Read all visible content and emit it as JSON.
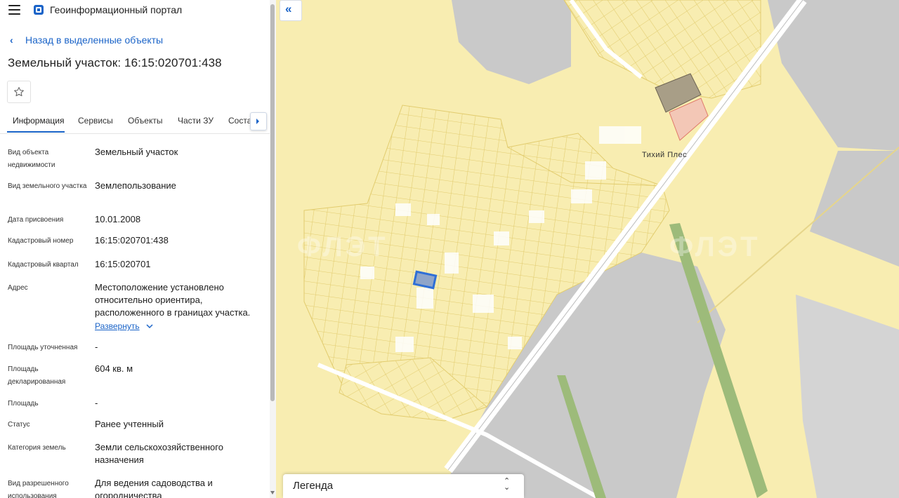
{
  "header": {
    "portal_title": "Геоинформационный портал",
    "menu_icon": "hamburger-icon",
    "logo_icon": "portal-logo-icon"
  },
  "navigation": {
    "back_label": "Назад в выделенные объекты"
  },
  "object": {
    "title": "Земельный участок: 16:15:020701:438",
    "favorite_icon": "star-icon"
  },
  "tabs": [
    {
      "label": "Информация",
      "active": true
    },
    {
      "label": "Сервисы"
    },
    {
      "label": "Объекты"
    },
    {
      "label": "Части ЗУ"
    },
    {
      "label": "Соста"
    }
  ],
  "properties": [
    {
      "label": "Вид объекта недвижимости",
      "value": "Земельный участок"
    },
    {
      "label": "Вид земельного участка",
      "value": "Землепользование"
    },
    {
      "label": "Дата присвоения",
      "value": "10.01.2008"
    },
    {
      "label": "Кадастровый номер",
      "value": "16:15:020701:438"
    },
    {
      "label": "Кадастровый квартал",
      "value": "16:15:020701"
    },
    {
      "label": "Адрес",
      "value": "Местоположение установлено относительно ориентира, расположенного в границах участка."
    },
    {
      "label": "Площадь уточненная",
      "value": "-"
    },
    {
      "label": "Площадь декларированная",
      "value": "604 кв. м"
    },
    {
      "label": "Площадь",
      "value": "-"
    },
    {
      "label": "Статус",
      "value": "Ранее учтенный"
    },
    {
      "label": "Категория земель",
      "value": "Земли сельскохозяйственного назначения"
    },
    {
      "label": "Вид разрешенного использования",
      "value": "Для ведения садоводства и огородничества"
    }
  ],
  "expand_label": "Развернуть",
  "map": {
    "place_label": "Тихий Плес",
    "legend_label": "Легенда",
    "collapse_icon": "double-chevron-left-icon",
    "colors": {
      "parcel_fill": "#f8edb1",
      "parcel_stroke": "#e2cc6e",
      "selected": "#2f6fd6",
      "road": "#ffffff",
      "grey_area": "#c9c9c9",
      "green_strip": "#9dbb7a"
    }
  },
  "watermark": "ФЛЭТ"
}
